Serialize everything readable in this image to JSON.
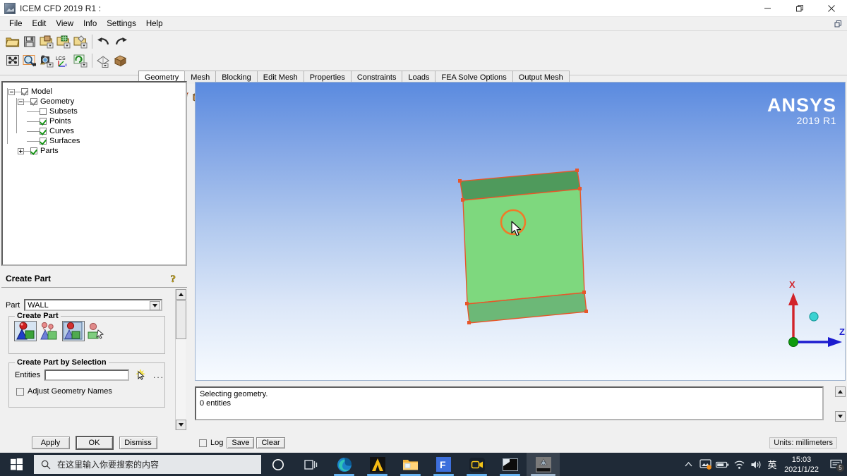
{
  "window": {
    "title": "ICEM CFD 2019 R1 :",
    "icon": "ansys-icem-icon",
    "minimize_label": "Minimize",
    "maximize_label": "Restore",
    "close_label": "Close"
  },
  "menubar": {
    "items": [
      {
        "label": "File"
      },
      {
        "label": "Edit"
      },
      {
        "label": "View"
      },
      {
        "label": "Info"
      },
      {
        "label": "Settings"
      },
      {
        "label": "Help"
      }
    ],
    "right_icon": "restore-down-icon"
  },
  "toolbar": {
    "file_group": [
      {
        "name": "open-file-icon",
        "title": "Open"
      },
      {
        "name": "save-file-icon",
        "title": "Save"
      },
      {
        "name": "open-geometry-icon",
        "title": "Open Geometry"
      },
      {
        "name": "open-mesh-icon",
        "title": "Open Mesh"
      },
      {
        "name": "open-blocking-icon",
        "title": "Open Blocking"
      }
    ],
    "undo_group": [
      {
        "name": "undo-icon",
        "title": "Undo"
      },
      {
        "name": "redo-icon",
        "title": "Redo"
      }
    ],
    "view_group": [
      {
        "name": "fit-window-icon",
        "title": "Fit Window"
      },
      {
        "name": "zoom-box-icon",
        "title": "Zoom Box"
      },
      {
        "name": "camera-view-icon",
        "title": "Save Picture"
      },
      {
        "name": "lcs-axes-icon",
        "title": "Local Coordinate System"
      },
      {
        "name": "refresh-display-icon",
        "title": "Refresh"
      }
    ],
    "display_group": [
      {
        "name": "render-mode-icon",
        "title": "Render Mode"
      },
      {
        "name": "solid-view-icon",
        "title": "Solid Simple Display"
      }
    ],
    "geometry_group": [
      {
        "name": "create-point-icon",
        "title": "Create Point"
      },
      {
        "name": "create-curve-icon",
        "title": "Create/Modify Curve"
      },
      {
        "name": "create-surface-icon",
        "title": "Create/Modify Surface"
      },
      {
        "name": "create-body-icon",
        "title": "Create Body"
      },
      {
        "name": "repair-geometry-icon",
        "title": "Repair Geometry"
      },
      {
        "name": "create-part-icon",
        "title": "Create Part"
      },
      {
        "name": "transform-geometry-icon",
        "title": "Transform Geometry"
      },
      {
        "name": "restore-dormant-icon",
        "title": "Restore Dormant Entities"
      },
      {
        "name": "delete-point-icon",
        "title": "Delete Point"
      },
      {
        "name": "delete-curve-icon",
        "title": "Delete Curve"
      },
      {
        "name": "delete-surface-icon",
        "title": "Delete Surface"
      },
      {
        "name": "delete-body-icon",
        "title": "Delete Body"
      },
      {
        "name": "delete-any-icon",
        "title": "Delete Any Entity"
      }
    ]
  },
  "tabs": [
    {
      "label": "Geometry",
      "active": true
    },
    {
      "label": "Mesh",
      "active": false
    },
    {
      "label": "Blocking",
      "active": false
    },
    {
      "label": "Edit Mesh",
      "active": false
    },
    {
      "label": "Properties",
      "active": false
    },
    {
      "label": "Constraints",
      "active": false
    },
    {
      "label": "Loads",
      "active": false
    },
    {
      "label": "FEA Solve Options",
      "active": false
    },
    {
      "label": "Output Mesh",
      "active": false
    }
  ],
  "tree": {
    "nodes": [
      {
        "label": "Model",
        "indent": 0,
        "expander": "minus",
        "check": "gray"
      },
      {
        "label": "Geometry",
        "indent": 1,
        "expander": "minus",
        "check": "gray"
      },
      {
        "label": "Subsets",
        "indent": 2,
        "expander": "none",
        "check": "empty"
      },
      {
        "label": "Points",
        "indent": 2,
        "expander": "none",
        "check": "checked"
      },
      {
        "label": "Curves",
        "indent": 2,
        "expander": "none",
        "check": "checked"
      },
      {
        "label": "Surfaces",
        "indent": 2,
        "expander": "none",
        "check": "checked"
      },
      {
        "label": "Parts",
        "indent": 1,
        "expander": "plus",
        "check": "checked"
      }
    ]
  },
  "panel": {
    "title": "Create Part",
    "help_icon": "help-question-icon",
    "part_label": "Part",
    "part_value": "WALL",
    "part_dropdown_icon": "chevron-down-icon",
    "create_part_group_label": "Create Part",
    "mode_icons": [
      {
        "name": "create-part-icon",
        "title": "Create Part",
        "selected": true
      },
      {
        "name": "create-part-from-points-icon",
        "title": "Create Assembly",
        "selected": false
      },
      {
        "name": "create-part-by-selection-icon",
        "title": "Create Part by Selection",
        "selected": true
      },
      {
        "name": "add-to-part-icon",
        "title": "Add to Part",
        "selected": false
      }
    ],
    "selection_group_label": "Create Part by Selection",
    "entities_label": "Entities",
    "entities_value": "",
    "select_cursor_icon": "select-entities-cursor-icon",
    "more_options_label": "...",
    "adjust_names_label": "Adjust Geometry Names",
    "adjust_names_checked": false,
    "scrollbar": {
      "up_icon": "scroll-up-arrow-icon",
      "down_icon": "scroll-down-arrow-icon"
    },
    "buttons": [
      {
        "label": "Apply",
        "default": false
      },
      {
        "label": "OK",
        "default": true
      },
      {
        "label": "Dismiss",
        "default": false
      }
    ]
  },
  "viewport": {
    "logo_main": "ANSYS",
    "logo_sub": "2019 R1",
    "background_top_color": "#5a8adf",
    "background_bottom_color": "#f7fbff",
    "geometry": {
      "surface_fill_color": "#7ed87e",
      "top_band_color": "#4f9a5c",
      "bottom_band_color": "#6cb877",
      "edge_color": "#e8562a",
      "point_color": "#e8562a",
      "selection_circle_color": "#f07a28"
    },
    "triad": {
      "x_label": "X",
      "x_color": "#d2232a",
      "z_label": "Z",
      "z_color": "#1c1ccf",
      "y_dot_color": "#3ad2d2",
      "origin_color": "#0f9b0f"
    },
    "cursor_icon": "mouse-pointer-icon"
  },
  "messages": {
    "lines": [
      "Selecting geometry.",
      "0 entities"
    ],
    "scroll_up_icon": "scroll-up-arrow-icon",
    "scroll_down_icon": "scroll-down-arrow-icon"
  },
  "logbar": {
    "log_label": "Log",
    "log_checked": false,
    "save_label": "Save",
    "clear_label": "Clear",
    "units_label": "Units: millimeters"
  },
  "taskbar": {
    "start_icon": "windows-start-icon",
    "search_icon": "search-icon",
    "search_placeholder": "在这里输入你要搜索的内容",
    "apps": [
      {
        "name": "cortana-icon",
        "title": "Cortana",
        "state": "idle"
      },
      {
        "name": "task-view-icon",
        "title": "Task View",
        "state": "idle"
      },
      {
        "name": "microsoft-edge-icon",
        "title": "Microsoft Edge",
        "state": "running"
      },
      {
        "name": "ansys-workbench-icon",
        "title": "ANSYS",
        "state": "running"
      },
      {
        "name": "file-explorer-icon",
        "title": "File Explorer",
        "state": "running"
      },
      {
        "name": "foxit-reader-icon",
        "title": "F",
        "state": "running"
      },
      {
        "name": "screen-recorder-icon",
        "title": "Recorder",
        "state": "running"
      },
      {
        "name": "terminal-icon",
        "title": "Terminal",
        "state": "running"
      },
      {
        "name": "icem-cfd-icon",
        "title": "ICEM CFD",
        "state": "active"
      }
    ],
    "tray": [
      {
        "name": "show-hidden-icons-chevron-icon"
      },
      {
        "name": "nvidia-settings-icon"
      },
      {
        "name": "battery-icon"
      },
      {
        "name": "wifi-icon"
      },
      {
        "name": "volume-icon"
      },
      {
        "name": "ime-language-icon",
        "label": "英"
      }
    ],
    "clock_time": "15:03",
    "clock_date": "2021/1/22",
    "notification_icon": "action-center-icon",
    "notification_count": "5"
  }
}
